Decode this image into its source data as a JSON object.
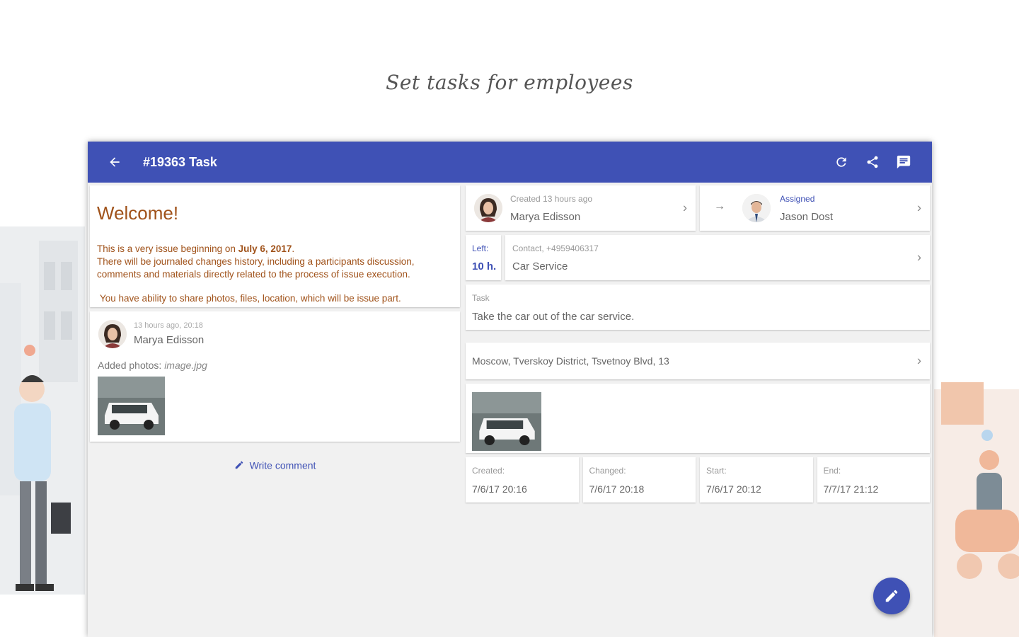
{
  "caption": "Set tasks for employees",
  "appbar": {
    "title": "#19363 Task",
    "color": "#3f51b5",
    "back_icon": "arrow-left-icon",
    "actions": [
      "refresh-icon",
      "share-icon",
      "chat-icon"
    ]
  },
  "welcome": {
    "heading": "Welcome!",
    "line1_prefix": "This is a very issue beginning on ",
    "line1_date": "July 6, 2017",
    "line1_suffix": ".",
    "line2": "There will be journaled changes history, including a participants discussion, comments and materials directly related to the process of issue execution.",
    "line3": "You have ability to share photos, files, location, which will be issue part."
  },
  "comment": {
    "meta": "13 hours ago, 20:18",
    "name": "Marya Edisson",
    "added_label": "Added photos:",
    "file": "image.jpg"
  },
  "write_comment": "Write comment",
  "creator": {
    "label": "Created 13 hours ago",
    "name": "Marya Edisson"
  },
  "assignee": {
    "label": "Assigned",
    "name": "Jason Dost"
  },
  "time_left": {
    "label": "Left:",
    "value": "10 h."
  },
  "contact": {
    "label": "Contact, +4959406317",
    "value": "Car Service"
  },
  "task": {
    "label": "Task",
    "value": "Take the car out of the car service."
  },
  "address": "Moscow, Tverskoy District, Tsvetnoy Blvd, 13",
  "dates": [
    {
      "label": "Created:",
      "value": "7/6/17 20:16"
    },
    {
      "label": "Changed:",
      "value": "7/6/17 20:18"
    },
    {
      "label": "Start:",
      "value": "7/6/17 20:12"
    },
    {
      "label": "End:",
      "value": "7/7/17 21:12"
    }
  ],
  "fab_icon": "edit-pencil-icon"
}
